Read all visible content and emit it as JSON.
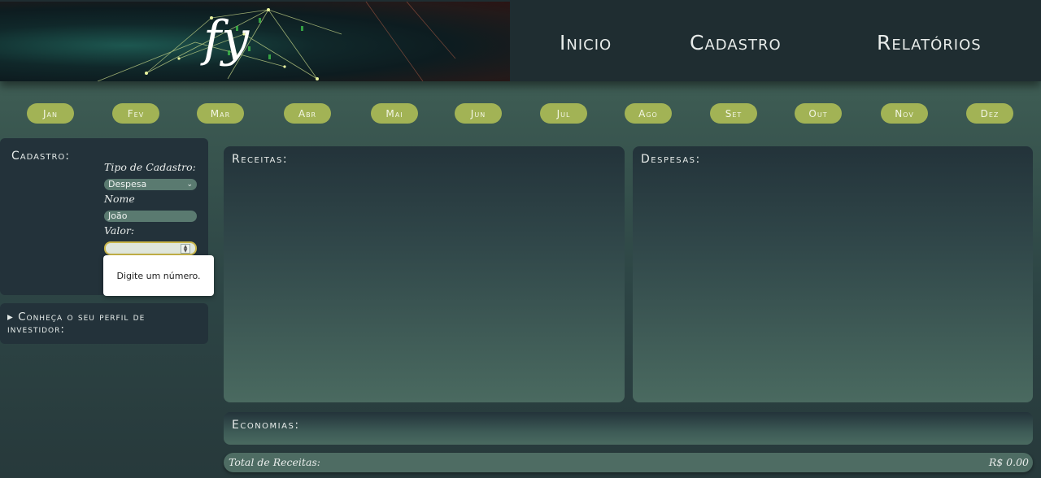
{
  "brand": {
    "logo_text": "fy"
  },
  "nav": {
    "inicio": "Inicio",
    "cadastro": "Cadastro",
    "relatorios": "Relatórios"
  },
  "months": [
    "Jan",
    "Fev",
    "Mar",
    "Abr",
    "Mai",
    "Jun",
    "Jul",
    "Ago",
    "Set",
    "Out",
    "Nov",
    "Dez"
  ],
  "cadastro": {
    "title": "Cadastro:",
    "tipo_label": "Tipo de Cadastro:",
    "tipo_value": "Despesa",
    "nome_label": "Nome",
    "nome_value": "João",
    "valor_label": "Valor:",
    "valor_value": "",
    "tooltip": "Digite um número."
  },
  "perfil": {
    "label": "▸ Conheça o seu perfil de investidor:"
  },
  "panels": {
    "receitas": "Receitas:",
    "despesas": "Despesas:",
    "economias": "Economias:"
  },
  "total": {
    "label": "Total de Receitas:",
    "value": "R$ 0.00"
  },
  "colors": {
    "month_pill": "#a2b355",
    "panel_dark": "#23323a",
    "header": "#1f2d31"
  }
}
